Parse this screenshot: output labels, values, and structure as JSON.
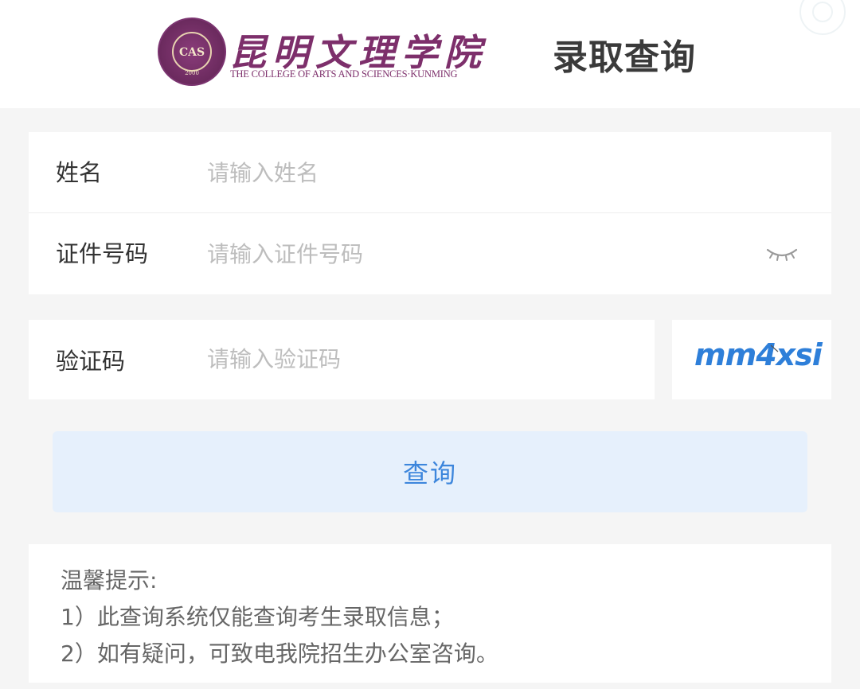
{
  "header": {
    "emblem_text": "CAS",
    "emblem_year": "2000",
    "college_name": "昆明文理学院",
    "college_name_en": "THE COLLEGE OF ARTS AND SCIENCES·KUNMING",
    "page_title": "录取查询"
  },
  "form": {
    "name": {
      "label": "姓名",
      "placeholder": "请输入姓名"
    },
    "id_number": {
      "label": "证件号码",
      "placeholder": "请输入证件号码"
    },
    "captcha": {
      "label": "验证码",
      "placeholder": "请输入验证码",
      "code": "mm4xsi"
    }
  },
  "query_button": {
    "label": "查询"
  },
  "notice": {
    "title": "温馨提示:",
    "lines": [
      "1）此查询系统仅能查询考生录取信息；",
      "2）如有疑问，可致电我院招生办公室咨询。"
    ]
  },
  "colors": {
    "brand_purple": "#7d2f6b",
    "accent_blue": "#3d86dc",
    "button_bg": "#e6f0fc",
    "page_bg": "#f5f5f5"
  },
  "icons": {
    "eye_toggle": "eye-closed-icon",
    "corner": "circle-icon"
  }
}
